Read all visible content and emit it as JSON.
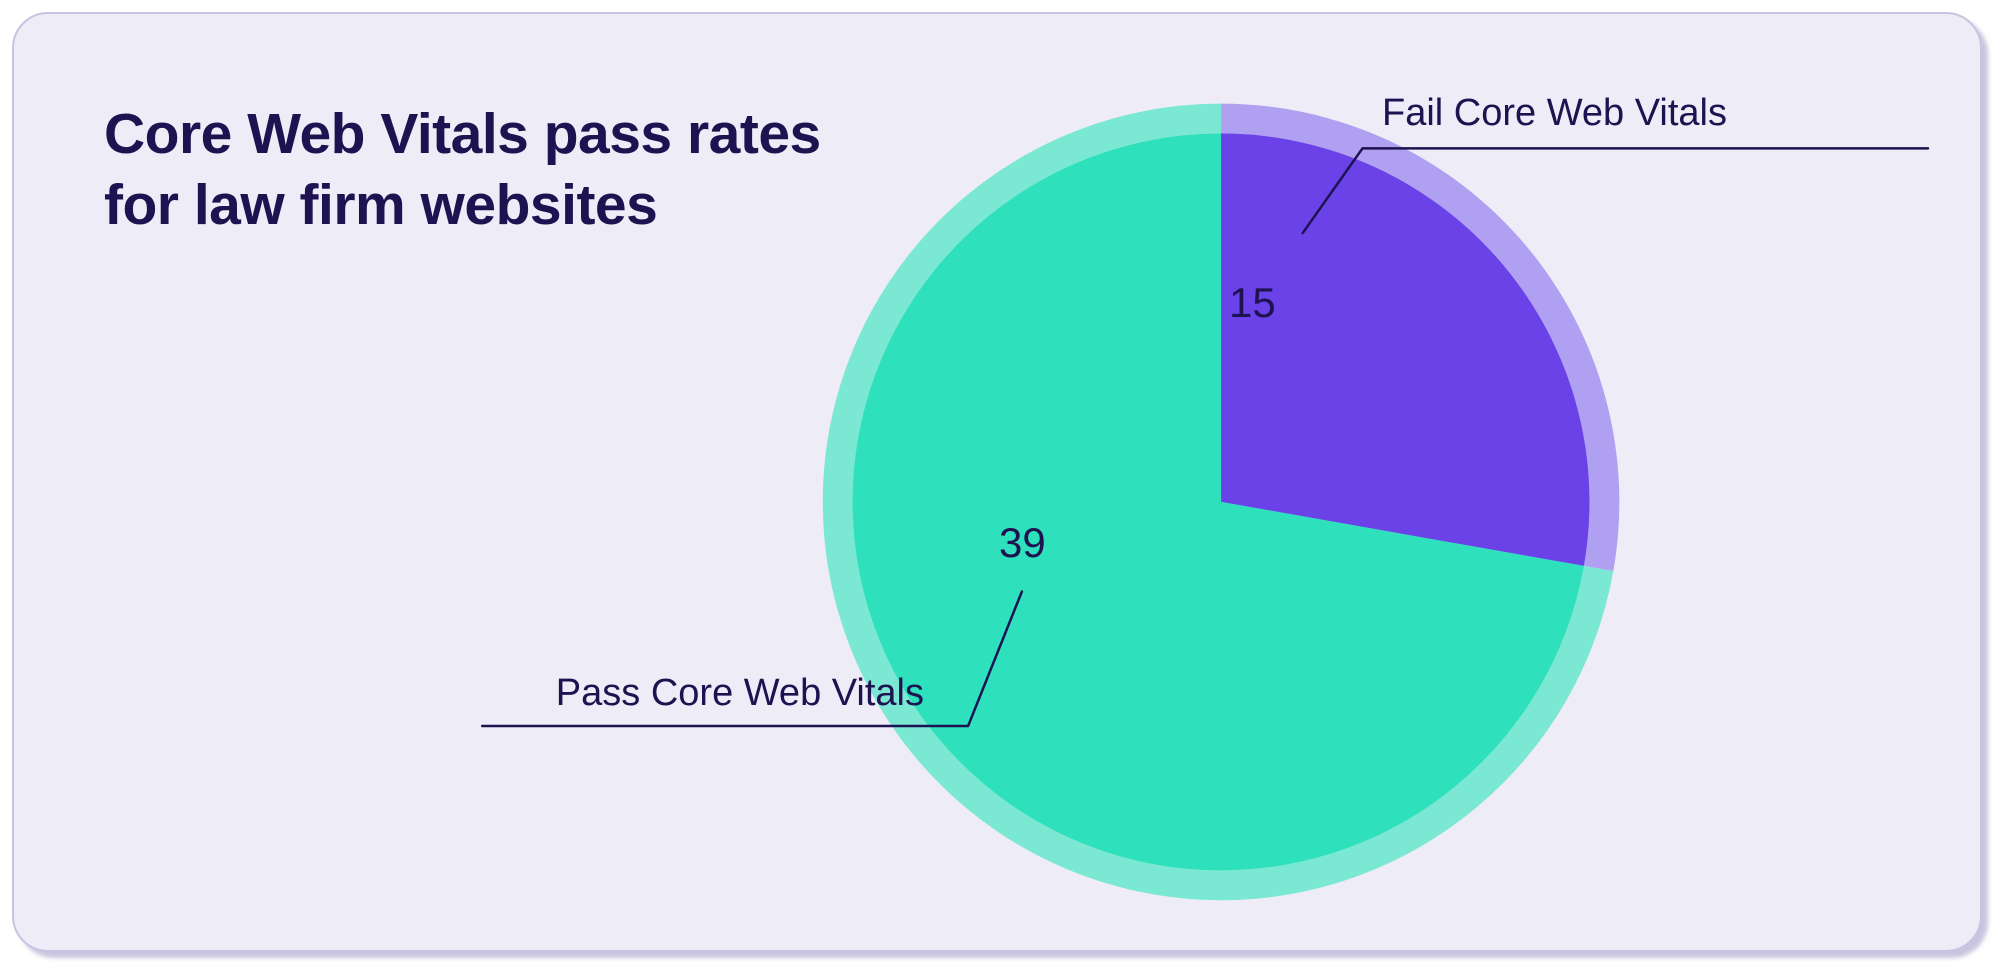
{
  "title": "Core Web Vitals pass rates for law firm websites",
  "labels": {
    "fail": "Fail Core Web Vitals",
    "pass": "Pass Core Web Vitals"
  },
  "values": {
    "fail": "15",
    "pass": "39"
  },
  "chart_data": {
    "type": "pie",
    "title": "Core Web Vitals pass rates for law firm websites",
    "categories": [
      "Pass Core Web Vitals",
      "Fail Core Web Vitals"
    ],
    "values": [
      39,
      15
    ],
    "series": [
      {
        "name": "Pass Core Web Vitals",
        "values": [
          39
        ],
        "color": "#2EE0BC"
      },
      {
        "name": "Fail Core Web Vitals",
        "values": [
          15
        ],
        "color": "#6A42E8"
      }
    ],
    "colors": {
      "pass": "#2EE0BC",
      "pass_halo": "#7BE8D4",
      "fail": "#6A42E8",
      "fail_halo": "#B0A0F2",
      "text": "#1E1250",
      "card_bg": "#EEECF6"
    },
    "xlabel": "",
    "ylabel": "",
    "legend_position": "callout",
    "grid": false
  }
}
